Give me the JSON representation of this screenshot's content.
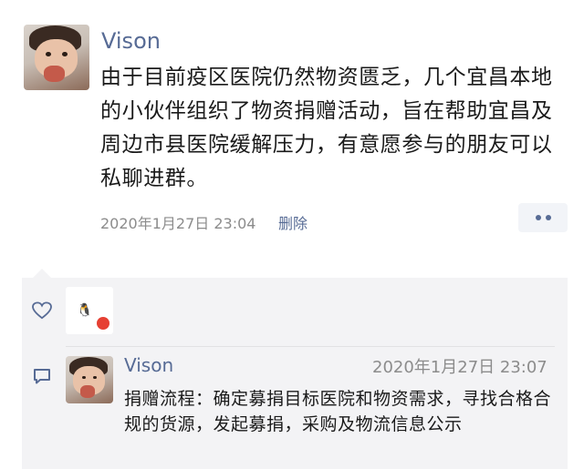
{
  "post": {
    "author": "Vison",
    "body": "由于目前疫区医院仍然物资匮乏，几个宜昌本地的小伙伴组织了物资捐赠活动，旨在帮助宜昌及周边市县医院缓解压力，有意愿参与的朋友可以私聊进群。",
    "time": "2020年1月27日 23:04",
    "delete_label": "删除"
  },
  "likes": {
    "icon": "heart-outline-icon"
  },
  "comment": {
    "author": "Vison",
    "time": "2020年1月27日 23:07",
    "body": "捐赠流程：确定募捐目标医院和物资需求，寻找合格合规的货源，发起募捐，采购及物流信息公示",
    "icon": "comment-bubble-icon"
  },
  "colors": {
    "link": "#576b95",
    "meta": "#8c8c8c",
    "comment_bg": "#f3f3f5"
  }
}
